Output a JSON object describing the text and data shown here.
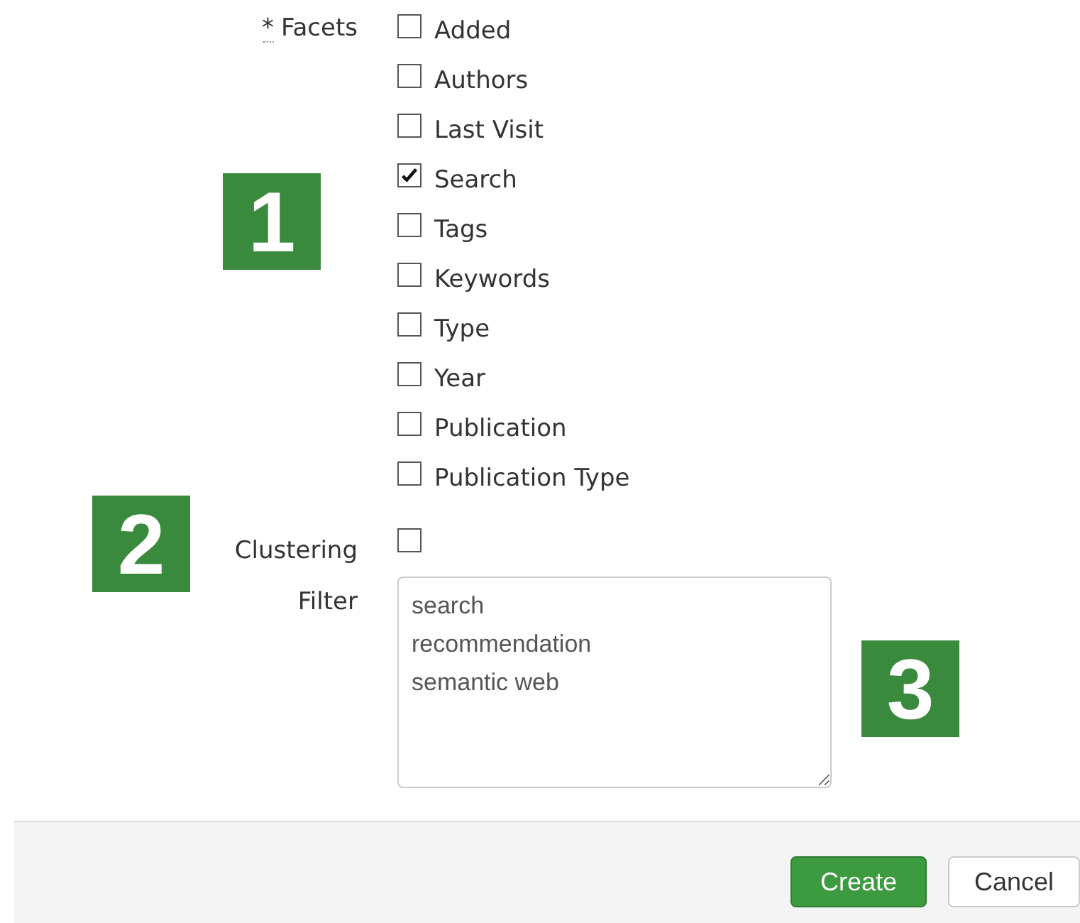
{
  "facets": {
    "required_mark": "*",
    "label": "Facets",
    "options": [
      {
        "label": "Added",
        "checked": false
      },
      {
        "label": "Authors",
        "checked": false
      },
      {
        "label": "Last Visit",
        "checked": false
      },
      {
        "label": "Search",
        "checked": true
      },
      {
        "label": "Tags",
        "checked": false
      },
      {
        "label": "Keywords",
        "checked": false
      },
      {
        "label": "Type",
        "checked": false
      },
      {
        "label": "Year",
        "checked": false
      },
      {
        "label": "Publication",
        "checked": false
      },
      {
        "label": "Publication Type",
        "checked": false
      }
    ]
  },
  "clustering": {
    "label": "Clustering",
    "checked": false
  },
  "filter": {
    "label": "Filter",
    "value": "search\nrecommendation\nsemantic web"
  },
  "callouts": [
    {
      "label": "1"
    },
    {
      "label": "2"
    },
    {
      "label": "3"
    }
  ],
  "buttons": [
    {
      "label": "Create",
      "kind": "primary"
    },
    {
      "label": "Cancel",
      "kind": "default"
    }
  ]
}
